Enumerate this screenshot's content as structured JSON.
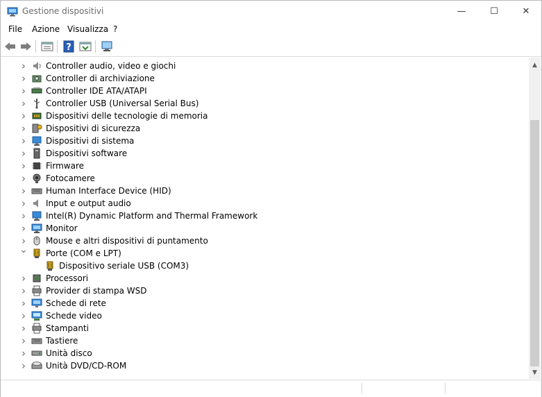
{
  "window": {
    "title": "Gestione dispositivi",
    "minimize_glyph": "—",
    "maximize_glyph": "☐",
    "close_glyph": "✕"
  },
  "menu": {
    "items": [
      "File",
      "Azione",
      "Visualizza",
      "?"
    ]
  },
  "toolbar": {
    "buttons": [
      "back-icon",
      "forward-icon",
      "properties-view-icon",
      "help-icon",
      "update-driver-icon",
      "scan-hardware-icon"
    ]
  },
  "tree": {
    "items": [
      {
        "label": "Controller audio, video e giochi",
        "icon": "speaker-icon"
      },
      {
        "label": "Controller di archiviazione",
        "icon": "storage-controller-icon"
      },
      {
        "label": "Controller IDE ATA/ATAPI",
        "icon": "ide-controller-icon"
      },
      {
        "label": "Controller USB (Universal Serial Bus)",
        "icon": "usb-icon"
      },
      {
        "label": "Dispositivi delle tecnologie di memoria",
        "icon": "memory-device-icon"
      },
      {
        "label": "Dispositivi di sicurezza",
        "icon": "security-key-icon"
      },
      {
        "label": "Dispositivi di sistema",
        "icon": "system-device-icon"
      },
      {
        "label": "Dispositivi software",
        "icon": "software-device-icon"
      },
      {
        "label": "Firmware",
        "icon": "firmware-chip-icon"
      },
      {
        "label": "Fotocamere",
        "icon": "camera-icon"
      },
      {
        "label": "Human Interface Device (HID)",
        "icon": "keyboard-hid-icon"
      },
      {
        "label": "Input e output audio",
        "icon": "audio-io-icon"
      },
      {
        "label": "Intel(R) Dynamic Platform and Thermal Framework",
        "icon": "thermal-framework-icon"
      },
      {
        "label": "Monitor",
        "icon": "monitor-icon"
      },
      {
        "label": "Mouse e altri dispositivi di puntamento",
        "icon": "mouse-icon"
      },
      {
        "label": "Porte (COM e LPT)",
        "icon": "port-icon",
        "expanded": true
      },
      {
        "label": "Dispositivo seriale USB (COM3)",
        "icon": "port-icon",
        "child": true
      },
      {
        "label": "Processori",
        "icon": "processor-icon"
      },
      {
        "label": "Provider di stampa WSD",
        "icon": "print-provider-icon"
      },
      {
        "label": "Schede di rete",
        "icon": "network-adapter-icon"
      },
      {
        "label": "Schede video",
        "icon": "display-adapter-icon"
      },
      {
        "label": "Stampanti",
        "icon": "printer-icon"
      },
      {
        "label": "Tastiere",
        "icon": "keyboard-icon"
      },
      {
        "label": "Unità disco",
        "icon": "disk-drive-icon"
      },
      {
        "label": "Unità DVD/CD-ROM",
        "icon": "dvd-drive-icon"
      }
    ]
  },
  "colors": {
    "highlight_fill": "#ffff3a",
    "highlight_border": "#c0141c"
  }
}
